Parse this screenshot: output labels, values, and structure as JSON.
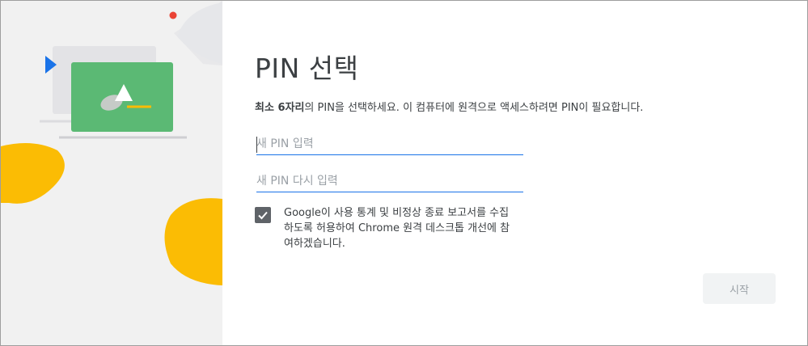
{
  "dialog": {
    "title": "PIN 선택",
    "description": {
      "emphasis": "최소 6자리",
      "rest": "의 PIN을 선택하세요. 이 컴퓨터에 원격으로 액세스하려면 PIN이 필요합니다."
    },
    "pin_field": {
      "placeholder": "새 PIN 입력",
      "value": ""
    },
    "pin_confirm_field": {
      "placeholder": "새 PIN 다시 입력",
      "value": ""
    },
    "consent": {
      "checked": true,
      "label": "Google이 사용 통계 및 비정상 종료 보고서를 수집하도록 허용하여 Chrome 원격 데스크톱 개선에 참여하겠습니다."
    },
    "start_button": {
      "label": "시작",
      "enabled": false
    }
  },
  "colors": {
    "accent": "#1a73e8",
    "illustration_green": "#5bb974",
    "illustration_yellow": "#fbbc04",
    "illustration_blue": "#1a73e8",
    "illustration_red": "#ea4335",
    "panel_bg": "#f1f1f1"
  },
  "icons": {
    "checkbox": "check-icon",
    "illustration": "remote-desktop-illustration"
  }
}
